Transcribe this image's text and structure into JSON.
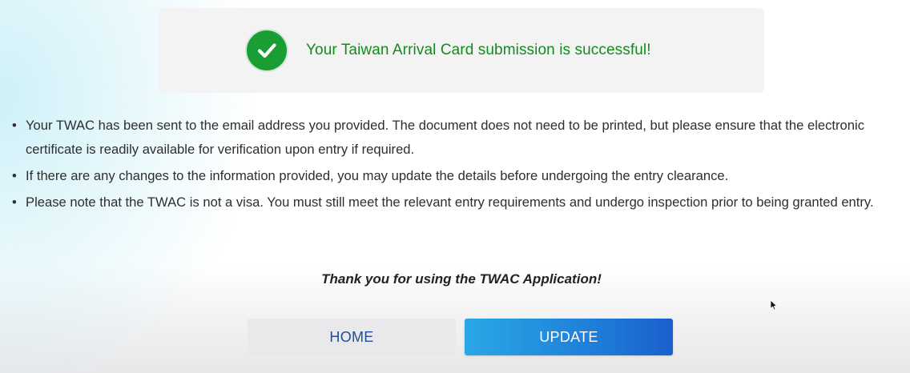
{
  "banner": {
    "icon": "check-circle-icon",
    "message": "Your Taiwan Arrival Card submission is successful!",
    "success_color": "#1a9e34"
  },
  "notes": [
    "Your TWAC has been sent to the email address you provided. The document does not need to be printed, but please ensure that the electronic certificate is readily available for verification upon entry if required.",
    "If there are any changes to the information provided, you may update the details before undergoing the entry clearance.",
    "Please note that the TWAC is not a visa. You must still meet the relevant entry requirements and undergo inspection prior to being granted entry."
  ],
  "thanks": "Thank you for using the TWAC Application!",
  "buttons": {
    "home": "HOME",
    "update": "UPDATE"
  },
  "colors": {
    "update_button": "#1f7fd9",
    "home_text": "#1f4f9a"
  }
}
